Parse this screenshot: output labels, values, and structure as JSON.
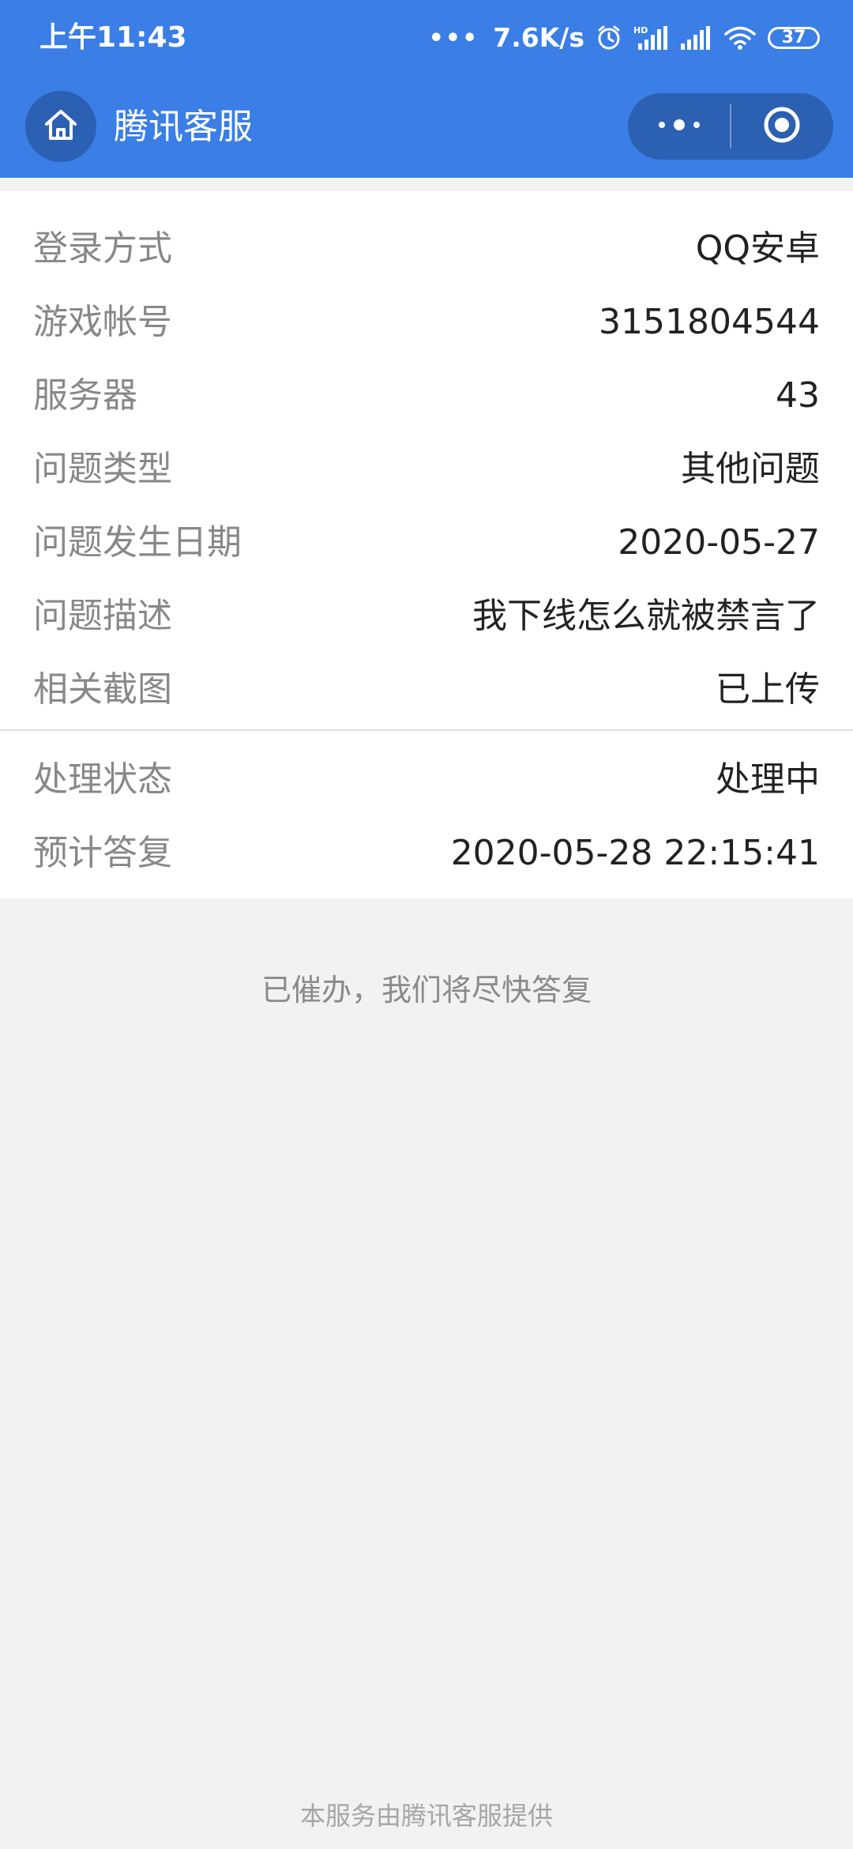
{
  "status_bar": {
    "time": "上午11:43",
    "net_speed": "7.6K/s",
    "signal_dots": "•••",
    "battery": "37",
    "icons": [
      "alarm-icon",
      "hd-signal-icon",
      "signal-icon",
      "wifi-icon",
      "battery-icon"
    ]
  },
  "nav": {
    "title": "腾讯客服",
    "home_icon": "home-icon",
    "more_icon": "more-dots-icon",
    "close_icon": "mini-program-close-icon"
  },
  "details": {
    "rows": [
      {
        "label": "登录方式",
        "value": "QQ安卓"
      },
      {
        "label": "游戏帐号",
        "value": "3151804544"
      },
      {
        "label": "服务器",
        "value": "43"
      },
      {
        "label": "问题类型",
        "value": "其他问题"
      },
      {
        "label": "问题发生日期",
        "value": "2020-05-27"
      },
      {
        "label": "问题描述",
        "value": "我下线怎么就被禁言了"
      },
      {
        "label": "相关截图",
        "value": "已上传"
      }
    ]
  },
  "status": {
    "rows": [
      {
        "label": "处理状态",
        "value": "处理中"
      },
      {
        "label": "预计答复",
        "value": "2020-05-28 22:15:41"
      }
    ]
  },
  "urge_message": "已催办，我们将尽快答复",
  "footer": "本服务由腾讯客服提供",
  "colors": {
    "header_bg": "#3a7ee6",
    "button_bg": "#2b60b3",
    "page_bg": "#f2f2f2",
    "card_bg": "#ffffff",
    "label": "#888888",
    "value": "#222222"
  }
}
